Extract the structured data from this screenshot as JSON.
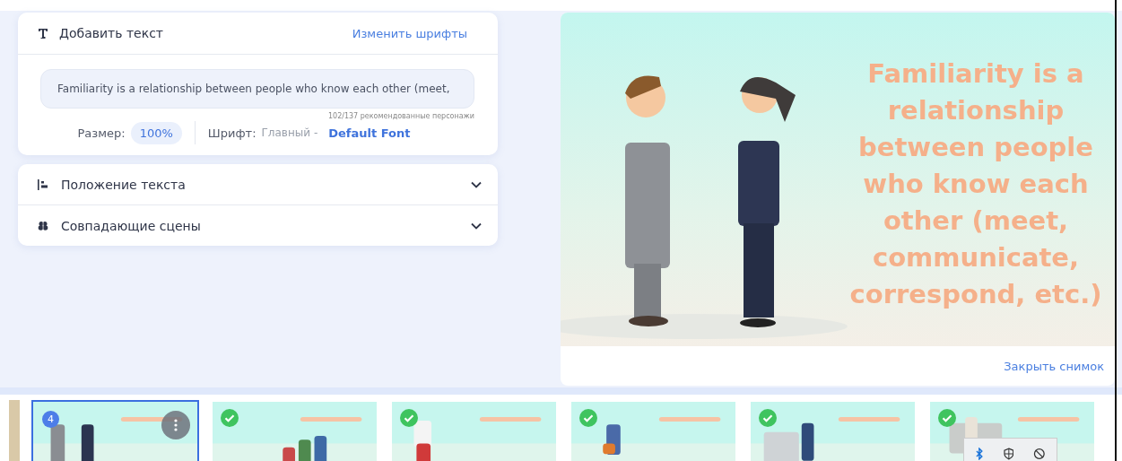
{
  "add_text": {
    "title": "Добавить текст",
    "change_fonts_link": "Изменить шрифты",
    "text_value": "Familiarity is a relationship between people who know each other (meet,",
    "counter": "102/137 рекомендованные персонажи",
    "size_label": "Размер:",
    "size_value": "100%",
    "font_label": "Шрифт:",
    "font_category": "Главный -",
    "font_name": "Default Font"
  },
  "sections": [
    {
      "title": "Положение текста",
      "kind": "position",
      "expanded": false
    },
    {
      "title": "Совпадающие сцены",
      "kind": "scenes",
      "expanded": false
    }
  ],
  "preview": {
    "caption": "Familiarity is a relationship between people who know each other (meet, communicate, correspond, etc.)",
    "close_link": "Закрыть снимок"
  },
  "scenes": [
    {
      "kind": "numbered",
      "badge": "4",
      "selected": true
    },
    {
      "kind": "done",
      "selected": false
    },
    {
      "kind": "done",
      "selected": false
    },
    {
      "kind": "done",
      "selected": false
    },
    {
      "kind": "done",
      "selected": false
    },
    {
      "kind": "done",
      "selected": false
    }
  ]
}
